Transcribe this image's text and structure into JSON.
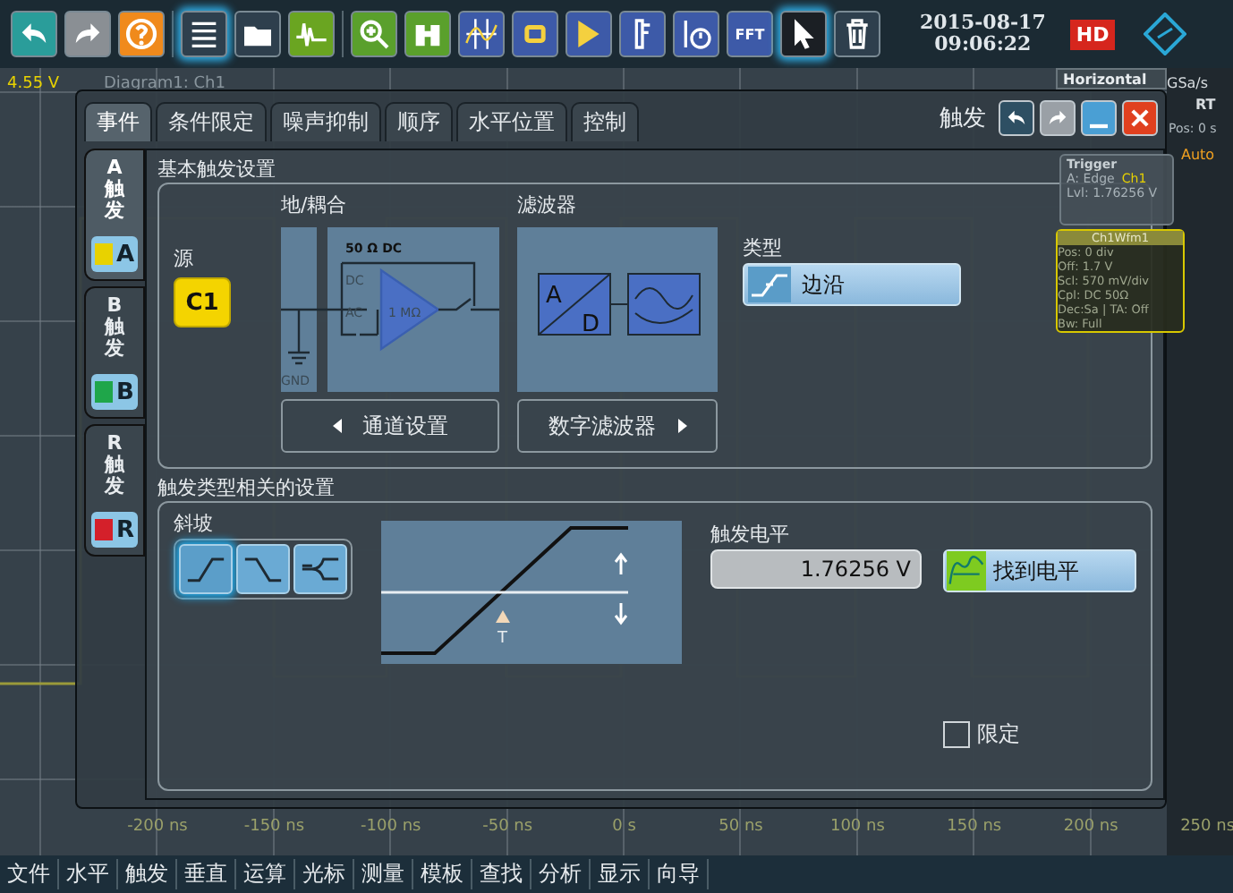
{
  "toolbar": {
    "fft_label": "FFT",
    "date": "2015-08-17",
    "time": "09:06:22",
    "hd_badge": "HD"
  },
  "diagram": {
    "title": "Diagram1: Ch1",
    "y_top": "4.55 V",
    "x_labels": [
      "-200 ns",
      "-150 ns",
      "-100 ns",
      "-50 ns",
      "0 s",
      "50 ns",
      "100 ns",
      "150 ns",
      "200 ns",
      "250 ns"
    ]
  },
  "horizontal_panel": {
    "title": "Horizontal",
    "rate": "GSa/s",
    "mode": "RT",
    "pos": "Pos: 0 s"
  },
  "trigger_panel": {
    "title": "Trigger",
    "source": "A:  Edge",
    "channel": "Ch1",
    "level": "Lvl: 1.76256 V",
    "mode": "Auto"
  },
  "waveform_panel": {
    "title": "Ch1Wfm1",
    "lines": [
      "Pos: 0 div",
      "Off: 1.7 V",
      "Scl: 570 mV/div",
      "Cpl: DC 50Ω",
      "Dec:Sa | TA: Off",
      "Bw: Full"
    ]
  },
  "dialog": {
    "title": "触发",
    "tabs": [
      {
        "label": "事件",
        "selected": true
      },
      {
        "label": "条件限定",
        "selected": false
      },
      {
        "label": "噪声抑制",
        "selected": false
      },
      {
        "label": "顺序",
        "selected": false
      },
      {
        "label": "水平位置",
        "selected": false
      },
      {
        "label": "控制",
        "selected": false
      }
    ],
    "side_tabs": [
      {
        "label": "A触发",
        "badge": "A",
        "color": "#e8d200",
        "selected": true
      },
      {
        "label": "B触发",
        "badge": "B",
        "color": "#1fa64a",
        "selected": false
      },
      {
        "label": "R触发",
        "badge": "R",
        "color": "#d4202a",
        "selected": false
      }
    ],
    "basic": {
      "title": "基本触发设置",
      "source_label": "源",
      "source": "C1",
      "coupling_label": "地/耦合",
      "coupling_caption": "50 Ω DC",
      "dc": "DC",
      "ac": "AC",
      "impedance": "1 MΩ",
      "gnd": "GND",
      "filter_label": "滤波器",
      "adc_a": "A",
      "adc_d": "D",
      "type_label": "类型",
      "type": "边沿",
      "channel_button": "通道设置",
      "filter_button": "数字滤波器"
    },
    "specific": {
      "title": "触发类型相关的设置",
      "slope_label": "斜坡",
      "slopes": [
        {
          "kind": "rising",
          "selected": true
        },
        {
          "kind": "falling",
          "selected": false
        },
        {
          "kind": "either",
          "selected": false
        }
      ],
      "marker": "T",
      "level_label": "触发电平",
      "level_value": "1.76256 V",
      "find_level": "找到电平",
      "qualify": {
        "label": "限定",
        "checked": false
      }
    }
  },
  "menu": [
    "文件",
    "水平",
    "触发",
    "垂直",
    "运算",
    "光标",
    "测量",
    "模板",
    "查找",
    "分析",
    "显示",
    "向导"
  ]
}
